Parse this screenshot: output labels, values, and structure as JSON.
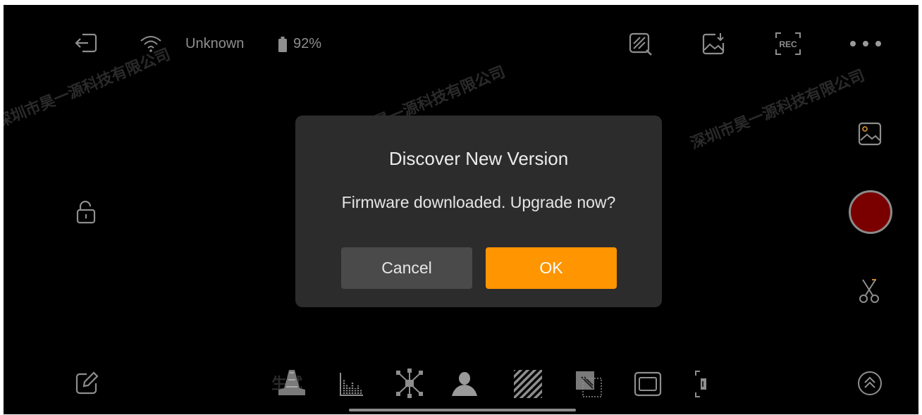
{
  "colors": {
    "background": "#000000",
    "dialog_bg": "#2c2c2c",
    "cancel_bg": "#4a4a4a",
    "ok_bg": "#ff9500",
    "record_fill": "#7a0000",
    "icon_gray": "#8e8e8e"
  },
  "status_bar": {
    "network": "Unknown",
    "battery": "92%"
  },
  "watermark": {
    "text_long": "深圳市昊一源科技有限公司",
    "text_short": "生试"
  },
  "dialog": {
    "title": "Discover New Version",
    "message": "Firmware downloaded. Upgrade now?",
    "cancel_label": "Cancel",
    "ok_label": "OK"
  },
  "icons": {
    "top_left": [
      "exit-icon",
      "wifi-icon",
      "battery-icon"
    ],
    "top_right": [
      "edit-image-icon",
      "save-image-icon",
      "rec-icon",
      "more-icon"
    ],
    "left": [
      "unlock-icon",
      "edit-icon"
    ],
    "right": [
      "gallery-icon",
      "record-button",
      "scissors-icon",
      "expand-up-icon"
    ],
    "bottom_tools": [
      "waveform-icon",
      "histogram-icon",
      "vectorscope-icon",
      "skin-tone-icon",
      "zebra-icon",
      "false-color-icon",
      "frame-guide-icon",
      "aspect-ratio-icon"
    ]
  }
}
